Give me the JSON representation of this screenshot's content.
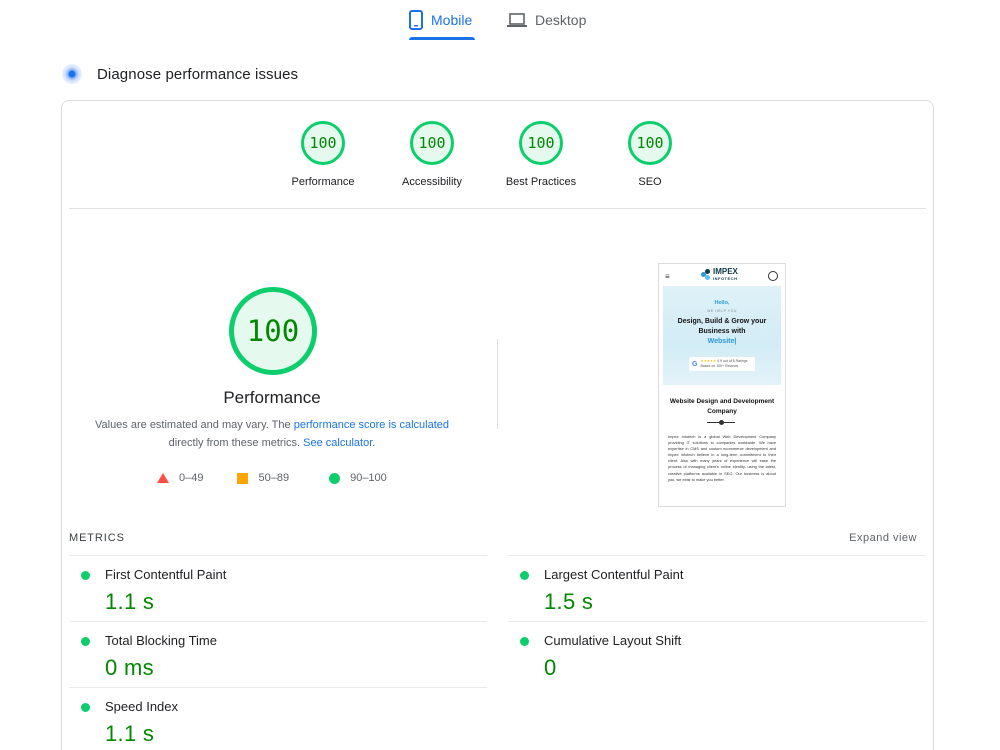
{
  "tabs": {
    "mobile_label": "Mobile",
    "desktop_label": "Desktop",
    "active": "Mobile"
  },
  "diagnose": {
    "title": "Diagnose performance issues"
  },
  "summary": [
    {
      "score": "100",
      "label": "Performance"
    },
    {
      "score": "100",
      "label": "Accessibility"
    },
    {
      "score": "100",
      "label": "Best Practices"
    },
    {
      "score": "100",
      "label": "SEO"
    }
  ],
  "performance": {
    "score": "100",
    "title": "Performance",
    "note_prefix": "Values are estimated and may vary. The ",
    "note_link": "performance score is calculated",
    "note_middle": " directly from these metrics. ",
    "calc_link": "See calculator.",
    "legend": {
      "fail": "0–49",
      "average": "50–89",
      "pass": "90–100"
    }
  },
  "thumbnail": {
    "menu_glyph": "≡",
    "logo_name": "IMPEX",
    "logo_sub": "INFOTECH",
    "hello": "Hello,",
    "we_help": "WE HELP YOU",
    "headline": "Design, Build & Grow your Business with",
    "headline_accent": "Website|",
    "google_g": "G",
    "review_stars": "★★★★★",
    "review_line1": "4.9 out of 5 Ratings",
    "review_line2": "Based on 100+ Reviews",
    "section_title": "Website Design and Development Company",
    "body": "Impex Infotech is a global Web Development Company providing IT solutions to companies worldwide. We have expertise in CMS and custom ecommerce development and Impex Infotech believe in a long-term commitment to their client. Also with many years of experience will ease the process of managing client's online identity, using the latest, creative platforms available in SEO. Our business is about you, we exist to make you better."
  },
  "metrics": {
    "label": "METRICS",
    "expand_label": "Expand view",
    "items": [
      {
        "name": "First Contentful Paint",
        "value": "1.1 s",
        "status": "pass"
      },
      {
        "name": "Largest Contentful Paint",
        "value": "1.5 s",
        "status": "pass"
      },
      {
        "name": "Total Blocking Time",
        "value": "0 ms",
        "status": "pass"
      },
      {
        "name": "Cumulative Layout Shift",
        "value": "0",
        "status": "pass"
      },
      {
        "name": "Speed Index",
        "value": "1.1 s",
        "status": "pass"
      }
    ]
  },
  "colors": {
    "pass": "#0cce6b",
    "pass_text": "#008800",
    "average": "#ffa400",
    "fail": "#ff4e42",
    "accent": "#1a73e8"
  }
}
